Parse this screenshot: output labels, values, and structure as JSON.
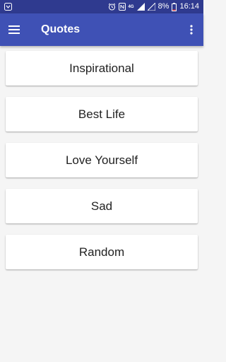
{
  "status_bar": {
    "battery_percent": "8%",
    "time": "16:14",
    "network_label": "4G",
    "icons": [
      "app-notification-icon",
      "alarm-icon",
      "nfc-icon",
      "signal-icon",
      "wifi-off-icon",
      "battery-icon"
    ]
  },
  "app_bar": {
    "title": "Quotes",
    "menu_icon": "hamburger-menu-icon",
    "overflow_icon": "more-vert-icon"
  },
  "categories": [
    {
      "label": "Inspirational"
    },
    {
      "label": "Best Life"
    },
    {
      "label": "Love Yourself"
    },
    {
      "label": "Sad"
    },
    {
      "label": "Random"
    }
  ],
  "colors": {
    "status_bar": "#2f3a8f",
    "app_bar": "#3f51b5",
    "background": "#f5f5f5",
    "card": "#ffffff"
  }
}
